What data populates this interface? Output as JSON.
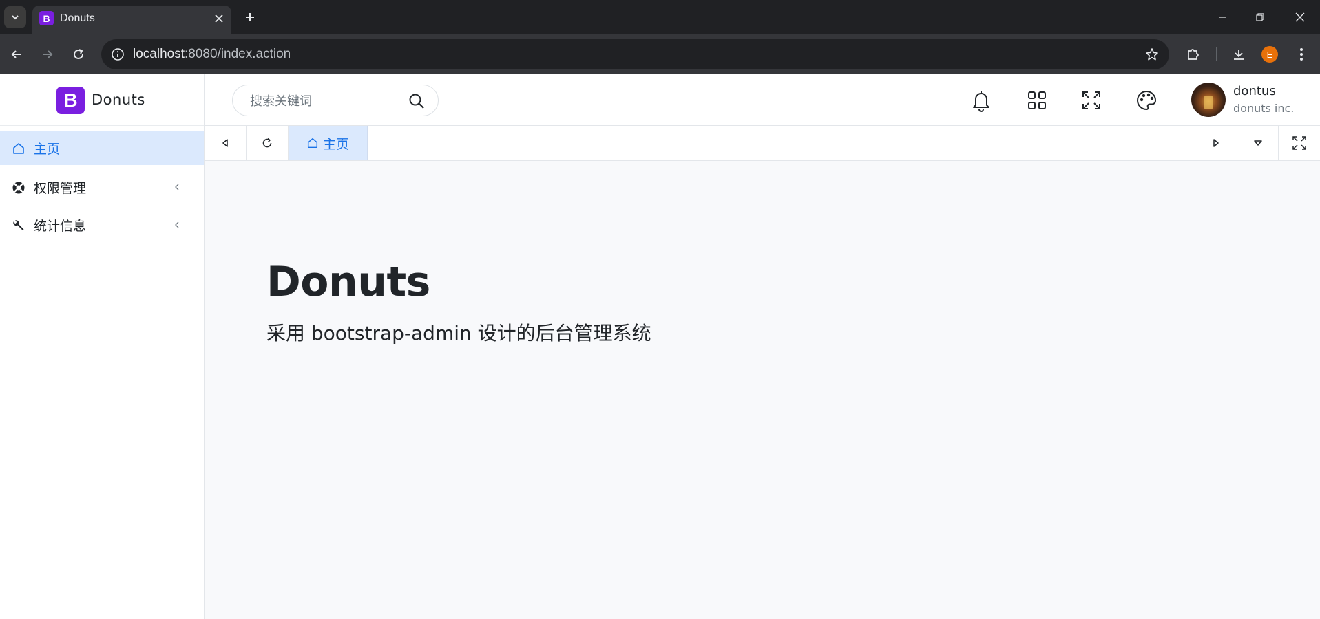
{
  "browser": {
    "tab_title": "Donuts",
    "tab_favicon_letter": "B",
    "url_host": "localhost",
    "url_rest": ":8080/index.action",
    "profile_initial": "E"
  },
  "brand": {
    "logo_letter": "B",
    "name": "Donuts",
    "color": "#7a1fe0"
  },
  "sidebar": {
    "items": [
      {
        "label": "主页",
        "icon": "home-icon",
        "active": true
      },
      {
        "label": "权限管理",
        "icon": "lifebuoy-icon",
        "active": false
      },
      {
        "label": "统计信息",
        "icon": "wrench-icon",
        "active": false
      }
    ]
  },
  "header": {
    "search_placeholder": "搜索关键词",
    "user": {
      "name": "dontus",
      "company": "donuts inc."
    }
  },
  "tabs": {
    "items": [
      {
        "label": "主页",
        "icon": "home-icon",
        "active": true
      }
    ]
  },
  "main": {
    "title": "Donuts",
    "subtitle": "采用 bootstrap-admin 设计的后台管理系统"
  },
  "colors": {
    "accent": "#1a73e8",
    "active_bg": "#dbe9fd",
    "content_bg": "#f8f9fb"
  }
}
